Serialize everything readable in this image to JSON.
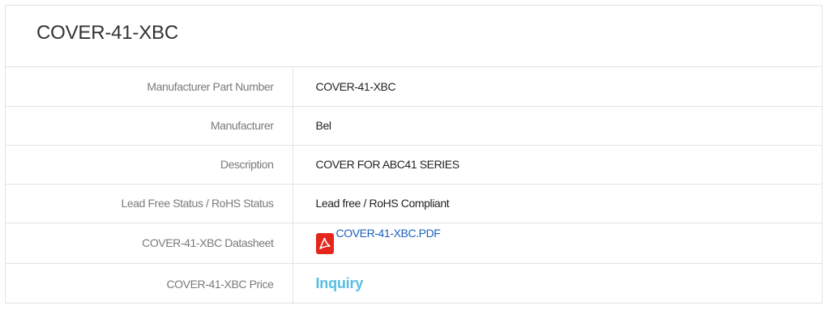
{
  "part": {
    "title": "COVER-41-XBC"
  },
  "specs": [
    {
      "label": "Manufacturer Part Number",
      "value": "COVER-41-XBC"
    },
    {
      "label": "Manufacturer",
      "value": "Bel"
    },
    {
      "label": "Description",
      "value": "COVER FOR ABC41 SERIES"
    },
    {
      "label": "Lead Free Status / RoHS Status",
      "value": "Lead free / RoHS Compliant"
    },
    {
      "label": "COVER-41-XBC Datasheet",
      "value": "COVER-41-XBC.PDF",
      "icon": "pdf-icon"
    },
    {
      "label": "COVER-41-XBC Price",
      "value": "Inquiry"
    }
  ],
  "colors": {
    "link": "#1a5fbf",
    "inquiry": "#56bde4",
    "pdf_icon": "#e4261c",
    "border": "#e3e3e3"
  }
}
